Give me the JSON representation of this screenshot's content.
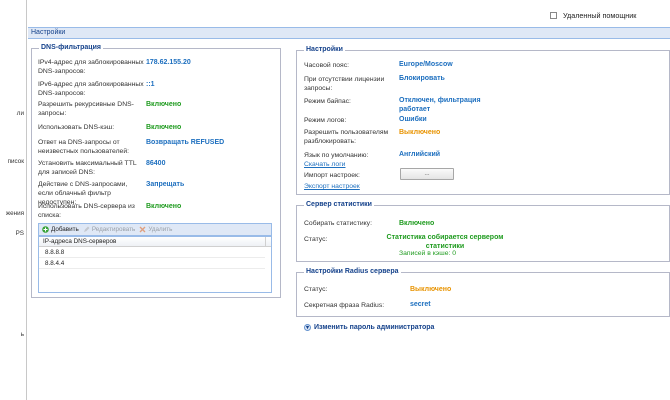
{
  "left_nav": {
    "items": [
      "ли",
      "писок",
      "жения",
      "PS",
      "ь"
    ]
  },
  "top": {
    "assistant_label": "Удаленный помощник"
  },
  "panel": {
    "title": "Настройки"
  },
  "dns": {
    "legend": "DNS-фильтрация",
    "ipv4_label": "IPv4-адрес для заблокированных DNS-запросов:",
    "ipv4_value": "178.62.155.20",
    "ipv6_label": "IPv6-адрес для заблокированных DNS-запросов:",
    "ipv6_value": "::1",
    "recursive_label": "Разрешить рекурсивные DNS-запросы:",
    "recursive_value": "Включено",
    "cache_label": "Использовать DNS-кэш:",
    "cache_value": "Включено",
    "unknown_label": "Ответ на DNS-запросы от неизвестных пользователей:",
    "unknown_value": "Возвращать REFUSED",
    "ttl_label": "Установить максимальный TTL для записей DNS:",
    "ttl_value": "86400",
    "cloud_label": "Действие с DNS-запросами, если облачный фильтр недоступен:",
    "cloud_value": "Запрещать",
    "useservers_label": "Использовать DNS-сервера из списка:",
    "useservers_value": "Включено",
    "toolbar": {
      "add": "Добавить",
      "edit": "Редактировать",
      "delete": "Удалить"
    },
    "grid_header": "IP-адреса DNS-серверов",
    "servers": [
      "8.8.8.8",
      "8.8.4.4"
    ]
  },
  "settings": {
    "legend": "Настройки",
    "tz_label": "Часовой пояс:",
    "tz_value": "Europe/Moscow",
    "nolicense_label": "При отсутствии лицензии запросы:",
    "nolicense_value": "Блокировать",
    "bypass_label": "Режим байпас:",
    "bypass_value": "Отключен, фильтрация работает",
    "logmode_label": "Режим логов:",
    "logmode_value": "Ошибки",
    "unblock_label": "Разрешить пользователям разблокировать:",
    "unblock_value": "Выключено",
    "lang_label": "Язык по умолчанию:",
    "lang_value": "Английский",
    "download_logs": "Скачать логи",
    "import_label": "Импорт настроек:",
    "import_button": "...",
    "export_link": "Экспорт настроек"
  },
  "stats": {
    "legend": "Сервер статистики",
    "collect_label": "Собирать статистику:",
    "collect_value": "Включено",
    "status_label": "Статус:",
    "status_value": "Статистика собирается сервером статистики",
    "cache_records": "Записей в кэше: 0"
  },
  "radius": {
    "legend": "Настройки Radius сервера",
    "status_label": "Статус:",
    "status_value": "Выключено",
    "secret_label": "Секретная фраза Radius:",
    "secret_value": "secret"
  },
  "admin": {
    "change_password": "Изменить пароль администратора"
  }
}
